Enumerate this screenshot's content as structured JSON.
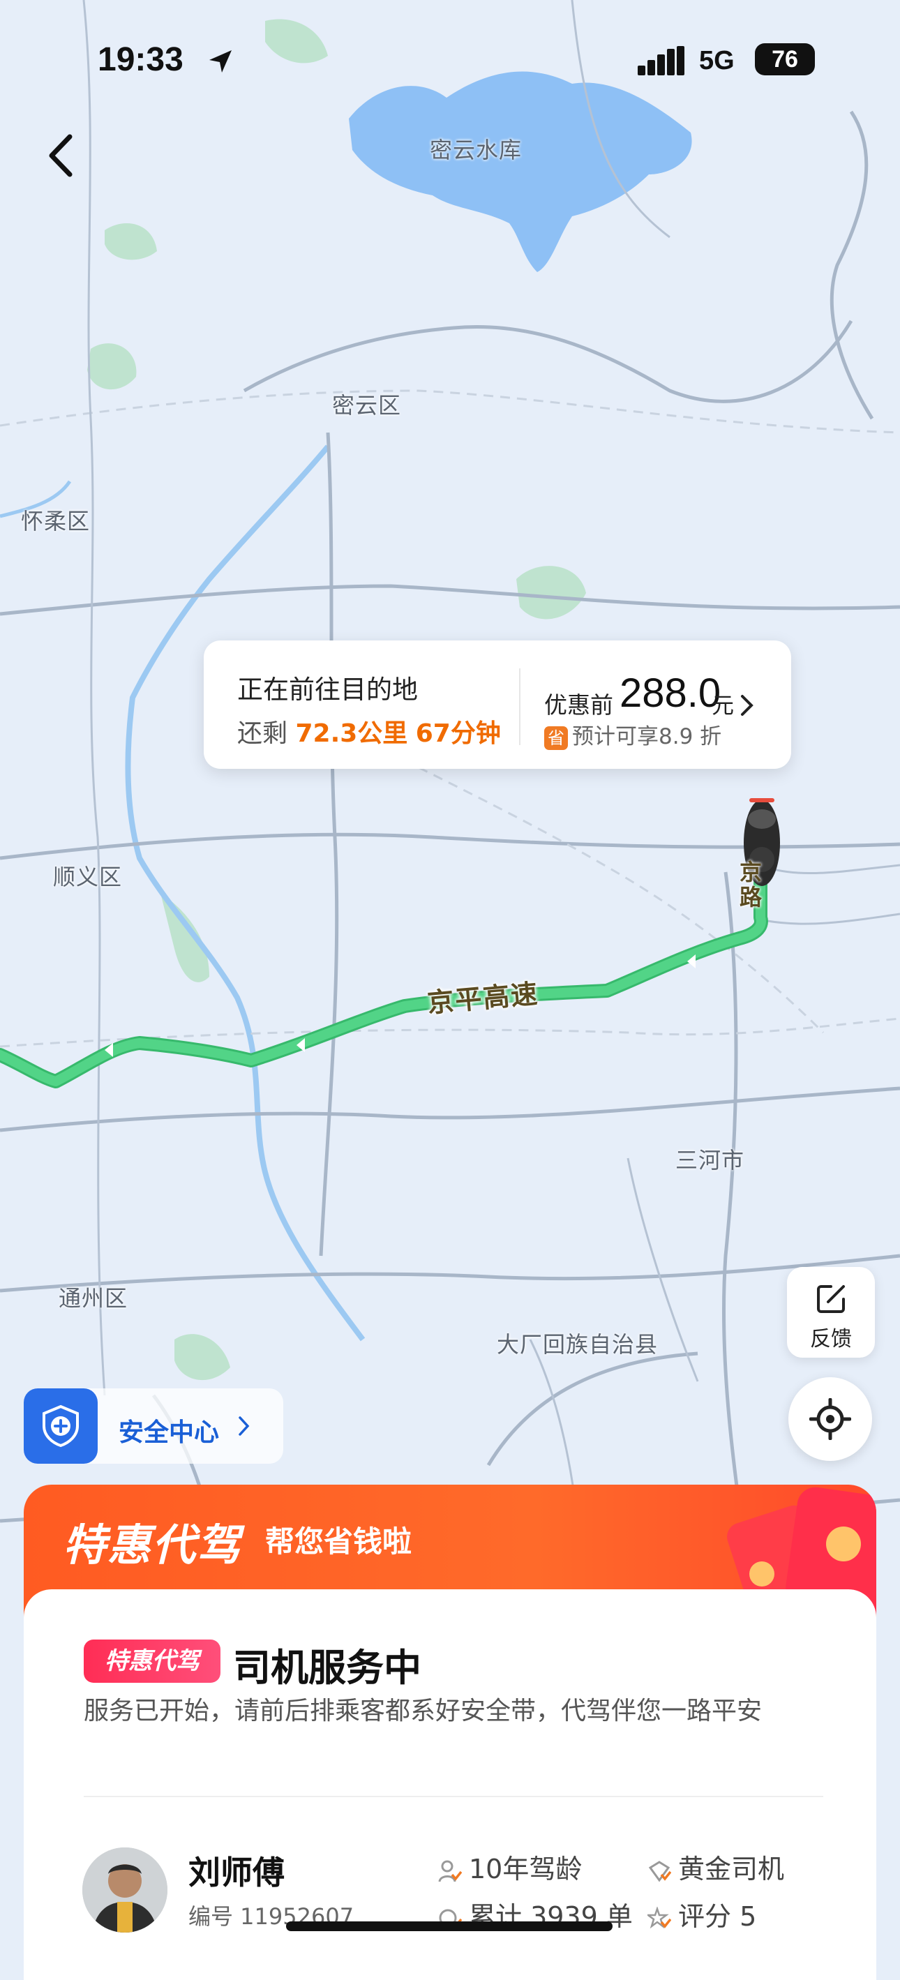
{
  "status_bar": {
    "time": "19:33",
    "network": "5G",
    "battery": "76"
  },
  "map": {
    "labels": {
      "miyun_reservoir": "密云水库",
      "miyun": "密云区",
      "huairou": "怀柔区",
      "shunyi": "顺义区",
      "sanhe": "三河市",
      "tongzhou": "通州区",
      "dachang": "大厂回族自治县",
      "road_side": "京\n路"
    },
    "route_label": "京平高速",
    "route_color": "#3dc47a"
  },
  "trip_card": {
    "status": "正在前往目的地",
    "remain_prefix": "还剩",
    "distance": "72.3公里",
    "duration": "67分钟",
    "price_prefix": "优惠前",
    "price": "288.0",
    "price_unit": "元",
    "discount_icon": "省",
    "discount_text": "预计可享8.9 折"
  },
  "feedback": {
    "label": "反馈",
    "icon": "edit-icon"
  },
  "locate": {
    "icon": "locate-icon"
  },
  "safety_center": {
    "label": "安全中心",
    "icon": "shield-plus-icon"
  },
  "promo": {
    "brand": "特惠代驾",
    "slogan": "帮您省钱啦",
    "accent": "#ff5b22"
  },
  "service": {
    "tag": "特惠代驾",
    "title": "司机服务中",
    "description": "服务已开始，请前后排乘客都系好安全带，代驾伴您一路平安"
  },
  "driver": {
    "name": "刘师傅",
    "id_label": "编号 11952607",
    "stats": [
      "10年驾龄",
      "黄金司机",
      "累计 3939 单",
      "评分 5"
    ]
  }
}
